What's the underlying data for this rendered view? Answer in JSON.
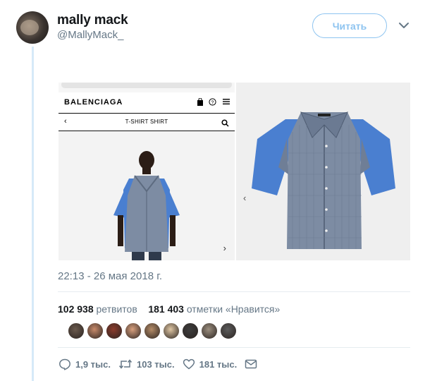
{
  "user": {
    "name": "mally mack",
    "handle": "@MallyMack_"
  },
  "follow_label": "Читать",
  "media": {
    "phone": {
      "brand": "BALENCIAGA",
      "product_title": "T-SHIRT SHIRT"
    }
  },
  "timestamp": "22:13 - 26 мая 2018 г.",
  "stats": {
    "retweets_count": "102 938",
    "retweets_label": "ретвитов",
    "likes_count": "181 403",
    "likes_label": "отметки «Нравится»"
  },
  "likers": [
    "#6b5a4d",
    "#c88a6a",
    "#8c3b2c",
    "#d9a07e",
    "#b58c68",
    "#e0c7a4",
    "#3d3d3d",
    "#9c8f7f",
    "#5d5d5d"
  ],
  "actions": {
    "replies": "1,9 тыс.",
    "retweets": "103 тыс.",
    "likes": "181 тыс."
  },
  "colors": {
    "accent": "#1da1f2",
    "follow_border": "#8ec4f0",
    "secondary_text": "#657786",
    "shirt_blue": "#4a7fd0",
    "plaid": "#7d8ca3"
  },
  "icons": {
    "menu_caret": "chevron-down-icon",
    "reply": "reply-icon",
    "retweet": "retweet-icon",
    "like": "heart-icon",
    "dm": "envelope-icon"
  }
}
